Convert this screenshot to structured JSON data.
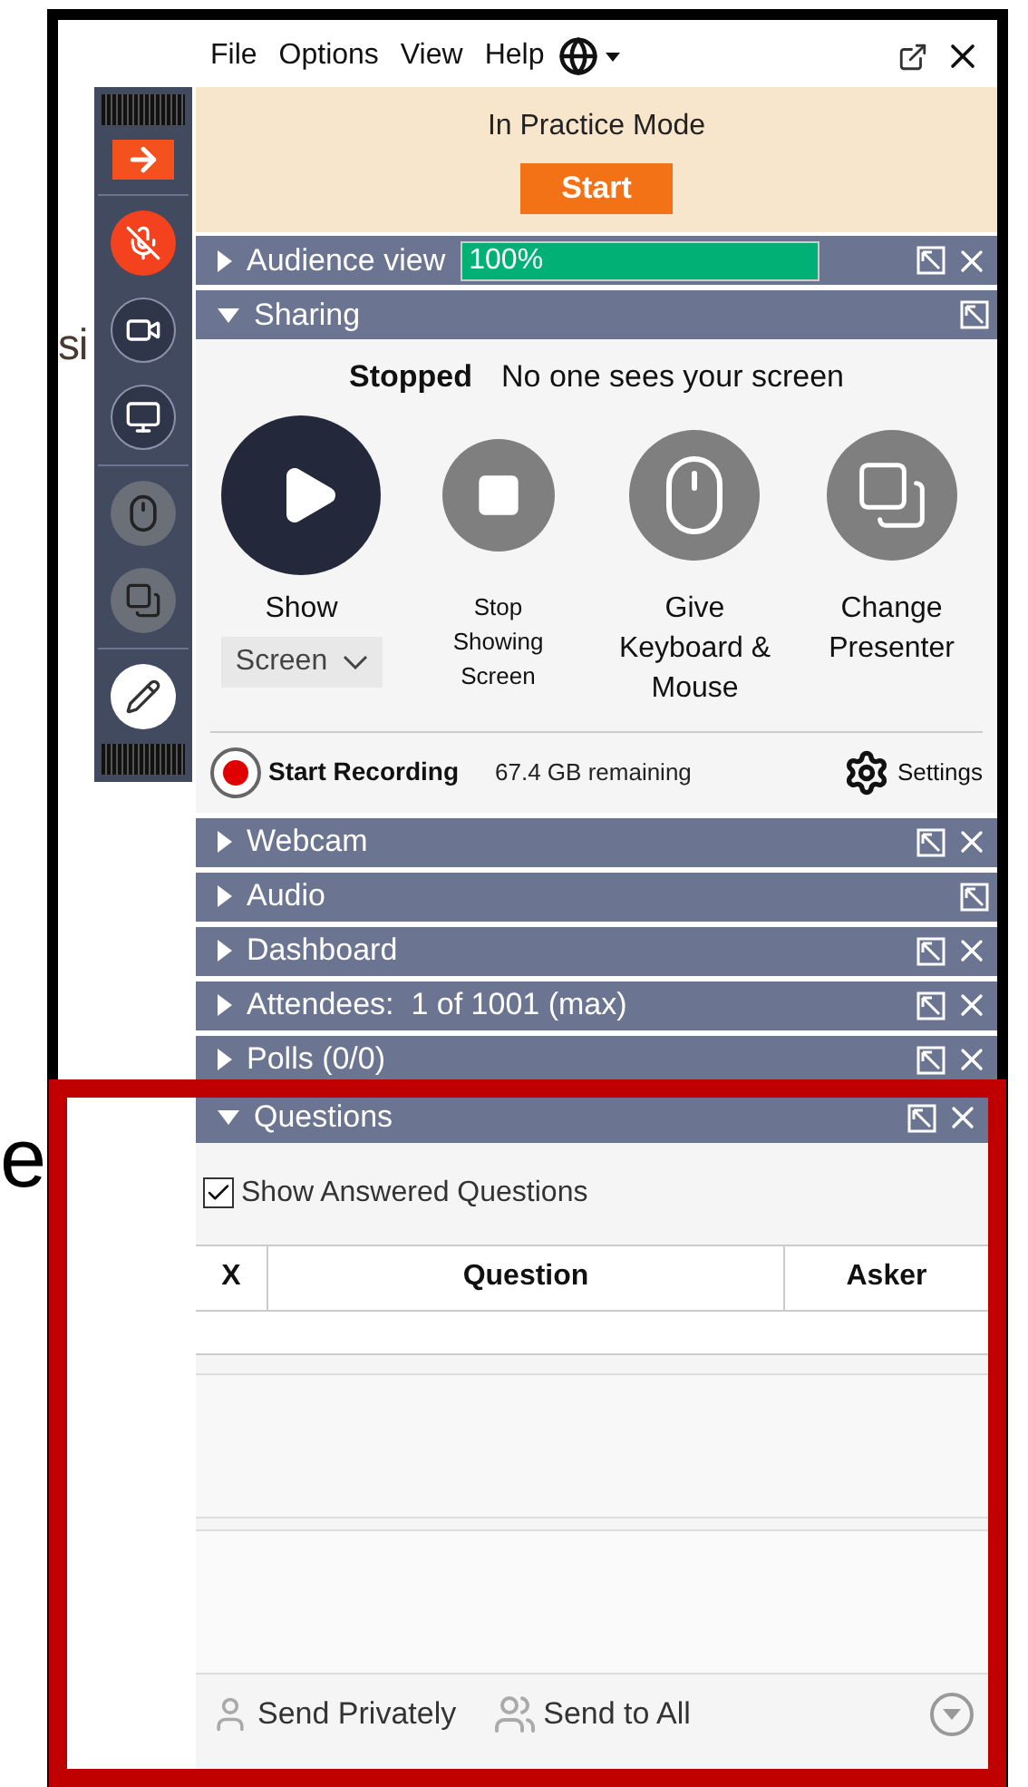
{
  "background_text": [
    {
      "text": "si"
    },
    {
      "text": "e"
    }
  ],
  "toolbar": {
    "mic_muted": true
  },
  "menu": [
    "File",
    "Options",
    "View",
    "Help"
  ],
  "practice": {
    "title": "In Practice Mode",
    "button": "Start"
  },
  "sections_top": [
    {
      "title": "Audience view",
      "expanded": false,
      "closable": true,
      "level": 1,
      "reading": "100%"
    },
    {
      "title": "Sharing",
      "expanded": true,
      "closable": false
    }
  ],
  "sharing": {
    "status": "Stopped",
    "message": "No one sees your screen",
    "actions": [
      {
        "kind": "play",
        "label": "Show",
        "disabled": false,
        "dropdown": "Screen"
      },
      {
        "kind": "stop",
        "label": "Stop Showing Screen",
        "disabled": true
      },
      {
        "kind": "mouse",
        "label": "Give Keyboard & Mouse",
        "disabled": true
      },
      {
        "kind": "presenter",
        "label": "Change Presenter",
        "disabled": true
      }
    ],
    "recording": {
      "label": "Start Recording",
      "remaining": "67.4 GB remaining",
      "settings": "Settings"
    }
  },
  "sections": [
    {
      "title": "Webcam",
      "expanded": false,
      "closable": true
    },
    {
      "title": "Audio",
      "expanded": false,
      "closable": false
    },
    {
      "title": "Dashboard",
      "expanded": false,
      "closable": true
    },
    {
      "title": "Attendees:  1 of 1001 (max)",
      "expanded": false,
      "closable": true
    },
    {
      "title": "Polls (0/0)",
      "expanded": false,
      "closable": true
    }
  ],
  "questions": {
    "title": "Questions",
    "expanded": true,
    "closable": true,
    "show_answered": {
      "label": "Show Answered Questions",
      "checked": true
    },
    "columns": [
      "X",
      "Question",
      "Asker"
    ],
    "footer": [
      "Send Privately",
      "Send to All"
    ]
  }
}
